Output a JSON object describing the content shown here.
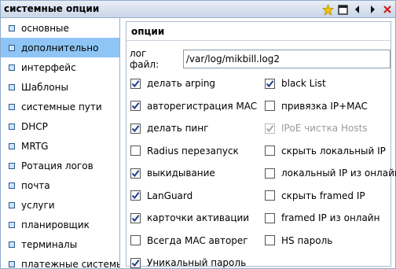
{
  "window": {
    "title": "системные опции",
    "tools": [
      "star-icon",
      "maximize-icon",
      "arrow-left-icon",
      "arrow-right-icon",
      "close-icon"
    ]
  },
  "sidebar": {
    "items": [
      {
        "label": "основные",
        "active": false
      },
      {
        "label": "дополнительно",
        "active": true
      },
      {
        "label": "интерфейс",
        "active": false
      },
      {
        "label": "Шаблоны",
        "active": false
      },
      {
        "label": "системные пути",
        "active": false
      },
      {
        "label": "DHCP",
        "active": false
      },
      {
        "label": "MRTG",
        "active": false
      },
      {
        "label": "Ротация логов",
        "active": false
      },
      {
        "label": "почта",
        "active": false
      },
      {
        "label": "услуги",
        "active": false
      },
      {
        "label": "планировщик",
        "active": false
      },
      {
        "label": "терминалы",
        "active": false
      },
      {
        "label": "платежные системы",
        "active": false
      }
    ]
  },
  "panel": {
    "title": "опции",
    "log_label": "лог файл:",
    "log_value": "/var/log/mikbill.log2"
  },
  "options_left": [
    {
      "label": "делать arping",
      "checked": true,
      "disabled": false
    },
    {
      "label": "авторегистрация MAC",
      "checked": true,
      "disabled": false
    },
    {
      "label": "делать пинг",
      "checked": true,
      "disabled": false
    },
    {
      "label": "Radius перезапуск",
      "checked": false,
      "disabled": false
    },
    {
      "label": "выкидывание",
      "checked": true,
      "disabled": false
    },
    {
      "label": "LanGuard",
      "checked": true,
      "disabled": false
    },
    {
      "label": "карточки активации",
      "checked": true,
      "disabled": false
    },
    {
      "label": "Всегда MAC авторег",
      "checked": false,
      "disabled": false
    },
    {
      "label": "Уникальный пароль",
      "checked": true,
      "disabled": false
    }
  ],
  "options_right": [
    {
      "label": "black List",
      "checked": true,
      "disabled": false
    },
    {
      "label": "привязка IP+MAC",
      "checked": false,
      "disabled": false
    },
    {
      "label": "IPoE чистка Hosts",
      "checked": true,
      "disabled": true
    },
    {
      "label": "скрыть локальный IP",
      "checked": false,
      "disabled": false
    },
    {
      "label": "локальный IP из онлайн",
      "checked": false,
      "disabled": false
    },
    {
      "label": "скрыть framed IP",
      "checked": false,
      "disabled": false
    },
    {
      "label": "framed IP из онлайн",
      "checked": false,
      "disabled": false
    },
    {
      "label": "HS пароль",
      "checked": false,
      "disabled": false
    }
  ],
  "colors": {
    "active_item": "#8ec5f5",
    "check_color": "#1f3c8c",
    "disabled_text": "#9a9a9a",
    "close_red": "#d11a1a",
    "star_yellow": "#f5c400"
  }
}
